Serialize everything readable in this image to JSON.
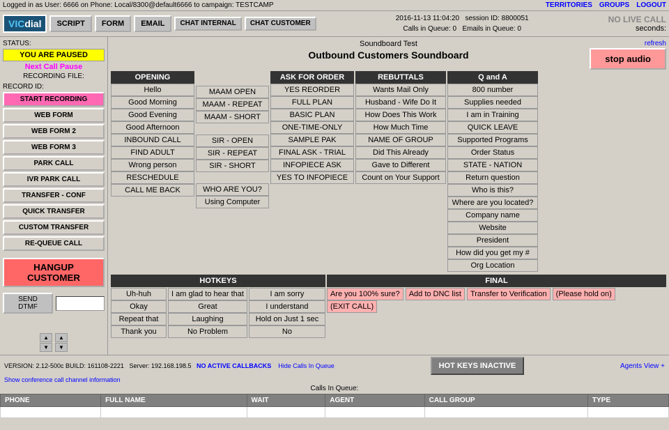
{
  "topbar": {
    "user_info": "Logged in as User: 6666 on Phone: Local/8300@default6666 to campaign: TESTCAMP",
    "territories": "TERRITORIES",
    "groups": "GROUPS",
    "logout": "LOGOUT"
  },
  "header": {
    "logo": "VICIdial",
    "nav": [
      "SCRIPT",
      "FORM",
      "EMAIL",
      "CHAT INTERNAL",
      "CHAT CUSTOMER"
    ],
    "datetime": "2016-11-13 11:04:20",
    "session": "session ID: 8800051",
    "calls_in_queue": "Calls in Queue: 0",
    "emails_in_queue": "Emails in Queue: 0",
    "no_live_call": "NO LIVE CALL",
    "seconds_label": "seconds:",
    "refresh": "refresh"
  },
  "status": {
    "you_are_paused": "YOU ARE PAUSED",
    "next_call_pause": "Next Call Pause",
    "recording_file": "RECORDING FILE:",
    "record_id_label": "RECORD ID:",
    "start_recording": "START RECORDING",
    "web_form": "WEB FORM",
    "web_form_2": "WEB FORM 2",
    "web_form_3": "WEB FORM 3",
    "park_call": "PARK CALL",
    "ivr_park_call": "IVR PARK CALL",
    "transfer_conf": "TRANSFER - CONF",
    "quick_transfer": "QUICK TRANSFER",
    "custom_transfer": "CUSTOM TRANSFER",
    "requeue_call": "RE-QUEUE CALL",
    "hangup_customer": "HANGUP CUSTOMER",
    "send_dtmf": "SEND DTMF"
  },
  "soundboard": {
    "subtitle": "Soundboard Test",
    "title": "Outbound Customers Soundboard",
    "stop_audio": "stop audio",
    "opening": {
      "header": "OPENING",
      "buttons": [
        "Hello",
        "Good Morning",
        "Good Evening",
        "Good Afternoon",
        "INBOUND CALL",
        "FIND ADULT",
        "Wrong person",
        "RESCHEDULE",
        "CALL ME BACK"
      ]
    },
    "maam": {
      "buttons": [
        "MAAM OPEN",
        "MAAM - REPEAT",
        "MAAM - SHORT",
        "",
        "SIR - OPEN",
        "SIR - REPEAT",
        "SIR - SHORT",
        "",
        "WHO ARE YOU?",
        "Using Computer"
      ]
    },
    "ask_for_order": {
      "header": "ASK FOR ORDER",
      "buttons": [
        "YES REORDER",
        "FULL PLAN",
        "BASIC PLAN",
        "ONE-TIME-ONLY",
        "SAMPLE PAK",
        "FINAL ASK - TRIAL",
        "INFOPIECE ASK",
        "YES TO INFOPIECE"
      ]
    },
    "rebuttals": {
      "header": "REBUTTALS",
      "buttons": [
        "Wants Mail Only",
        "Husband - Wife Do It",
        "How Does This Work",
        "How Much Time",
        "NAME OF GROUP",
        "Did This Already",
        "Gave to Different",
        "Count on Your Support"
      ]
    },
    "qanda": {
      "header": "Q and A",
      "buttons": [
        "800 number",
        "Supplies needed",
        "I am in Training",
        "QUICK LEAVE",
        "Supported Programs",
        "Order Status",
        "STATE - NATION",
        "Return question",
        "Who is this?",
        "Where are you located?",
        "Company name",
        "Website",
        "President",
        "How did you get my #",
        "Org Location"
      ]
    },
    "hotkeys": {
      "header": "HOTKEYS",
      "buttons_col1": [
        "Uh-huh",
        "Okay",
        "Repeat that",
        "Thank you"
      ],
      "buttons_col2": [
        "I am glad to hear that",
        "Great",
        "Laughing",
        "No Problem"
      ],
      "buttons_col3": [
        "I am sorry",
        "I understand",
        "Hold on Just 1 sec",
        "No"
      ]
    },
    "final": {
      "header": "FINAL",
      "buttons": [
        "Are you 100% sure?",
        "Add to DNC list",
        "Transfer to Verification",
        "(Please hold on)",
        "(EXIT CALL)"
      ]
    }
  },
  "bottom": {
    "version": "VERSION: 2.12-500c  BUILD: 161108-2221",
    "server": "Server: 192.168.198.5",
    "no_active_callbacks": "NO ACTIVE CALLBACKS",
    "hide_calls": "Hide Calls In Queue",
    "hot_keys_inactive": "HOT KEYS INACTIVE",
    "agents_view": "Agents View +",
    "show_conference": "Show conference call channel information",
    "calls_in_queue": "Calls In Queue:",
    "table_headers": [
      "PHONE",
      "FULL NAME",
      "WAIT",
      "AGENT",
      "CALL GROUP",
      "TYPE"
    ]
  }
}
